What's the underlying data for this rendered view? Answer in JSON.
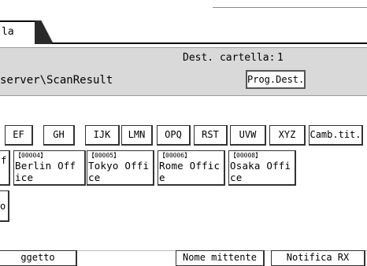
{
  "tab": {
    "label": "la"
  },
  "info": {
    "dest_label": "Dest. cartella:",
    "dest_value": "1",
    "path": "server\\ScanResult",
    "prog_dest_label": "Prog.Dest."
  },
  "index_buttons": [
    "EF",
    "GH",
    "IJK",
    "LMN",
    "OPQ",
    "RST",
    "UVW",
    "XYZ",
    "Camb.tit."
  ],
  "destinations": [
    {
      "code": "",
      "line1": "f",
      "line2": ""
    },
    {
      "code": "【00004】",
      "line1": "Berlin Off",
      "line2": "ice"
    },
    {
      "code": "【00005】",
      "line1": "Tokyo Offi",
      "line2": "ce"
    },
    {
      "code": "【00006】",
      "line1": "Rome Offic",
      "line2": "e"
    },
    {
      "code": "【00008】",
      "line1": "Osaka Offi",
      "line2": "ce"
    }
  ],
  "extra_button": "o",
  "bottom": {
    "subject": "ggetto",
    "sender_name": "Nome mittente",
    "notify_rx": "Notifica RX"
  }
}
